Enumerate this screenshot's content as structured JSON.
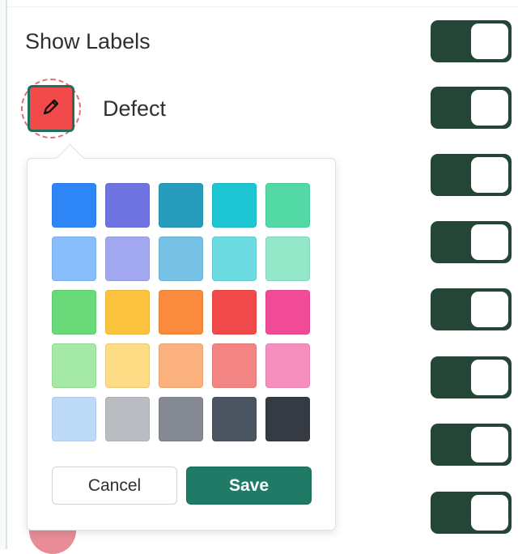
{
  "settings": {
    "show_labels_label": "Show Labels",
    "label_name": "Defect",
    "selected_color": "#f24a4a"
  },
  "toggles": [
    {
      "name": "show-labels-toggle",
      "on": true
    },
    {
      "name": "defect-toggle",
      "on": true
    },
    {
      "name": "label-toggle-3",
      "on": true
    },
    {
      "name": "label-toggle-4",
      "on": true
    },
    {
      "name": "label-toggle-5",
      "on": true
    },
    {
      "name": "label-toggle-6",
      "on": true
    },
    {
      "name": "label-toggle-7",
      "on": true
    },
    {
      "name": "label-toggle-8",
      "on": true
    }
  ],
  "color_picker": {
    "palette": [
      [
        "#2e86f6",
        "#7074e2",
        "#279cbc",
        "#1ec5d2",
        "#52d9a6"
      ],
      [
        "#86bdfa",
        "#a2a8ef",
        "#77c1e4",
        "#6cdbe2",
        "#93e8c9"
      ],
      [
        "#6ad97a",
        "#fbc33e",
        "#fa8a3d",
        "#f24a4a",
        "#f14b98"
      ],
      [
        "#a4e9a6",
        "#fedb85",
        "#fbb17e",
        "#f38484",
        "#f78fbe"
      ],
      [
        "#bedaf9",
        "#b9bdc2",
        "#848992",
        "#4b5562",
        "#353a43"
      ]
    ],
    "cancel_label": "Cancel",
    "save_label": "Save"
  },
  "colors": {
    "toggle_on": "#234636",
    "save_button": "#1f7a66",
    "selected_border": "#1f6f5b",
    "hidden_label_dot": "#e88d98"
  },
  "icons": {
    "edit": "pencil-icon"
  }
}
